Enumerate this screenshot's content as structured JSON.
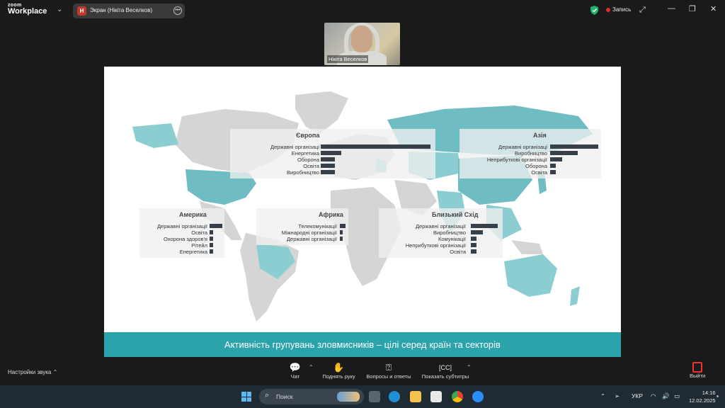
{
  "app": {
    "logo_small": "zoom",
    "logo_big": "Workplace",
    "screen_badge": "Н",
    "screen_tab_label": "Экран (Нікіта Веселков)",
    "record_label": "Запись"
  },
  "video": {
    "participant_name": "Нікіта Веселков"
  },
  "slide": {
    "footer_title": "Активність групувань зловмисників – цілі серед країн та секторів",
    "regions": [
      {
        "title": "Європа",
        "rows": [
          {
            "label": "Державні організаці",
            "value": 1.0
          },
          {
            "label": "Енергетика",
            "value": 0.19
          },
          {
            "label": "Оборона",
            "value": 0.13
          },
          {
            "label": "Освіта",
            "value": 0.13
          },
          {
            "label": "Виробництво",
            "value": 0.13
          }
        ]
      },
      {
        "title": "Азія",
        "rows": [
          {
            "label": "Державні організаці",
            "value": 1.0
          },
          {
            "label": "Виробництво",
            "value": 0.57
          },
          {
            "label": "Неприбуткові організації",
            "value": 0.25
          },
          {
            "label": "Оборона",
            "value": 0.12
          },
          {
            "label": "Освіта",
            "value": 0.12
          }
        ]
      },
      {
        "title": "Америка",
        "rows": [
          {
            "label": "Державні організації",
            "value": 1.0
          },
          {
            "label": "Освіта",
            "value": 0.25
          },
          {
            "label": "Охорона здоров'я",
            "value": 0.25
          },
          {
            "label": "Рітейл",
            "value": 0.25
          },
          {
            "label": "Енергетика",
            "value": 0.25
          }
        ]
      },
      {
        "title": "Африка",
        "rows": [
          {
            "label": "Телекомунікації",
            "value": 1.0
          },
          {
            "label": "Міжнародні організації",
            "value": 0.5
          },
          {
            "label": "Державні організації",
            "value": 0.5
          }
        ]
      },
      {
        "title": "Близький Схід",
        "rows": [
          {
            "label": "Державні організації",
            "value": 1.0
          },
          {
            "label": "Виробництво",
            "value": 0.45
          },
          {
            "label": "Комунікації",
            "value": 0.22
          },
          {
            "label": "Неприбуткові організації",
            "value": 0.22
          },
          {
            "label": "Освіта",
            "value": 0.22
          }
        ]
      }
    ]
  },
  "toolbar": {
    "sound_settings": "Настройки звука",
    "chat": "Чат",
    "raise_hand": "Поднять руку",
    "qa": "Вопросы и ответы",
    "captions": "Показать субтитры",
    "exit": "Выйти"
  },
  "taskbar": {
    "search_placeholder": "Поиск",
    "language": "УКР",
    "time": "14:16",
    "date": "12.02.2025"
  },
  "colors": {
    "teal": "#2aa3ab",
    "teal_light": "#8ccdd1",
    "map_gray": "#d5d5d5",
    "bar_dark": "#374048"
  }
}
